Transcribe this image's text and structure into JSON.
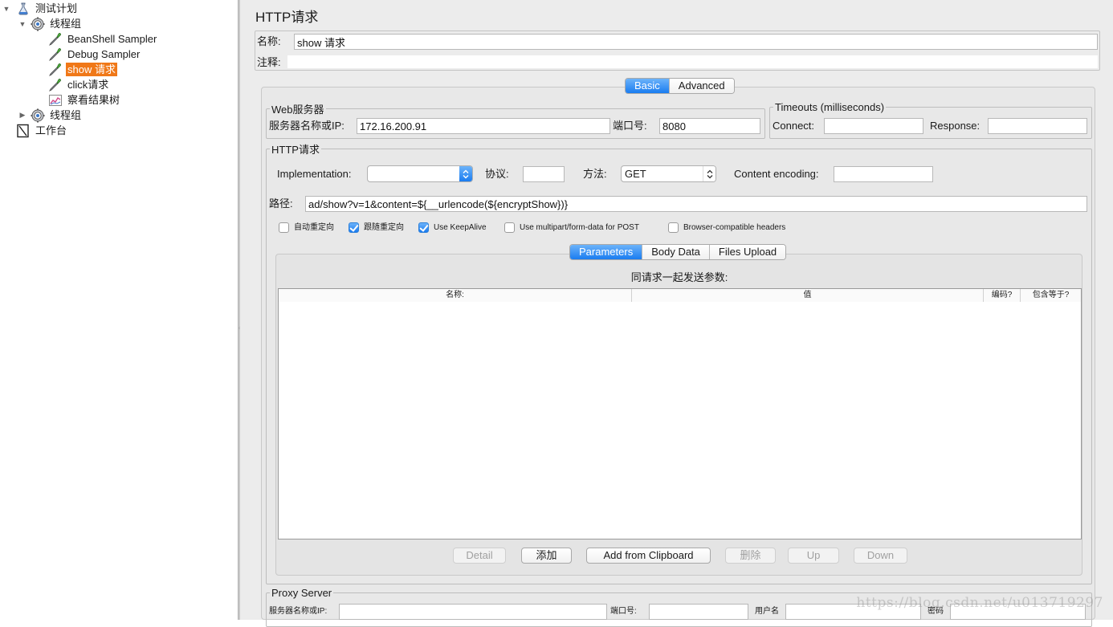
{
  "tree": {
    "items": [
      {
        "label": "测试计划",
        "icon": "test-plan-icon",
        "toggle": "▼"
      },
      {
        "label": "线程组",
        "icon": "thread-group-gear-icon",
        "toggle": "▼"
      },
      {
        "label": "BeanShell Sampler",
        "icon": "sampler-dropper-icon"
      },
      {
        "label": "Debug Sampler",
        "icon": "sampler-dropper-icon"
      },
      {
        "label": "show 请求",
        "icon": "sampler-dropper-icon",
        "selected": true
      },
      {
        "label": "click请求",
        "icon": "sampler-dropper-icon"
      },
      {
        "label": "察看结果树",
        "icon": "results-chart-icon"
      },
      {
        "label": "线程组",
        "icon": "thread-group-gear-icon",
        "toggle": "▶"
      },
      {
        "label": "工作台",
        "icon": "workbench-icon"
      }
    ]
  },
  "panel": {
    "title": "HTTP请求",
    "name_label": "名称:",
    "name_value": "show 请求",
    "comment_label": "注释:",
    "comment_value": ""
  },
  "config_tabs": {
    "basic": "Basic",
    "advanced": "Advanced",
    "active": "basic"
  },
  "web_server": {
    "legend": "Web服务器",
    "host_label": "服务器名称或IP:",
    "host_value": "172.16.200.91",
    "port_label": "端口号:",
    "port_value": "8080"
  },
  "timeouts": {
    "legend": "Timeouts (milliseconds)",
    "connect_label": "Connect:",
    "connect_value": "",
    "response_label": "Response:",
    "response_value": ""
  },
  "http_request": {
    "legend": "HTTP请求",
    "implementation_label": "Implementation:",
    "implementation_value": "",
    "protocol_label": "协议:",
    "protocol_value": "",
    "method_label": "方法:",
    "method_value": "GET",
    "encoding_label": "Content encoding:",
    "encoding_value": "",
    "path_label": "路径:",
    "path_value": "ad/show?v=1&content=${__urlencode(${encryptShow})}"
  },
  "options": [
    {
      "label": "自动重定向",
      "checked": false
    },
    {
      "label": "跟随重定向",
      "checked": true
    },
    {
      "label": "Use KeepAlive",
      "checked": true
    },
    {
      "label": "Use multipart/form-data for POST",
      "checked": false
    },
    {
      "label": "Browser-compatible headers",
      "checked": false
    }
  ],
  "param_tabs": {
    "parameters": "Parameters",
    "body_data": "Body Data",
    "files_upload": "Files Upload",
    "active": "parameters"
  },
  "params_table": {
    "caption": "同请求一起发送参数:",
    "columns": [
      "名称:",
      "值",
      "编码?",
      "包含等于?"
    ],
    "rows": []
  },
  "param_buttons": {
    "detail": "Detail",
    "add": "添加",
    "add_clipboard": "Add from Clipboard",
    "delete": "删除",
    "up": "Up",
    "down": "Down"
  },
  "proxy": {
    "legend": "Proxy Server",
    "host_label": "服务器名称或IP:",
    "port_label": "端口号:",
    "user_label": "用户名",
    "password_label": "密码"
  },
  "watermark": "https://blog.csdn.net/u013719297",
  "colors": {
    "selection": "#f07818",
    "accent_blue": "#1a7cf0",
    "panel_bg": "#ececec"
  }
}
